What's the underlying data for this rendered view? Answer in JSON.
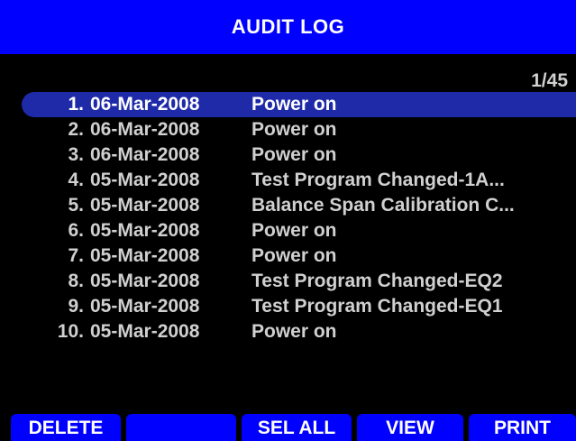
{
  "title": "AUDIT LOG",
  "page_indicator": "1/45",
  "entries": [
    {
      "num": "1.",
      "date": "06-Mar-2008",
      "event": "Power on"
    },
    {
      "num": "2.",
      "date": "06-Mar-2008",
      "event": "Power on"
    },
    {
      "num": "3.",
      "date": "06-Mar-2008",
      "event": "Power on"
    },
    {
      "num": "4.",
      "date": "05-Mar-2008",
      "event": "Test Program Changed-1A..."
    },
    {
      "num": "5.",
      "date": "05-Mar-2008",
      "event": "Balance Span Calibration C..."
    },
    {
      "num": "6.",
      "date": "05-Mar-2008",
      "event": "Power on"
    },
    {
      "num": "7.",
      "date": "05-Mar-2008",
      "event": "Power on"
    },
    {
      "num": "8.",
      "date": "05-Mar-2008",
      "event": "Test Program Changed-EQ2"
    },
    {
      "num": "9.",
      "date": "05-Mar-2008",
      "event": "Test Program Changed-EQ1"
    },
    {
      "num": "10.",
      "date": "05-Mar-2008",
      "event": "Power on"
    }
  ],
  "softkeys": {
    "key1": "DELETE",
    "key2": "",
    "key3": "SEL ALL",
    "key4": "VIEW",
    "key5": "PRINT"
  },
  "colors": {
    "accent": "#0000ff",
    "selection": "#1e2aa8",
    "background": "#000000",
    "text": "#d0d0d0"
  }
}
